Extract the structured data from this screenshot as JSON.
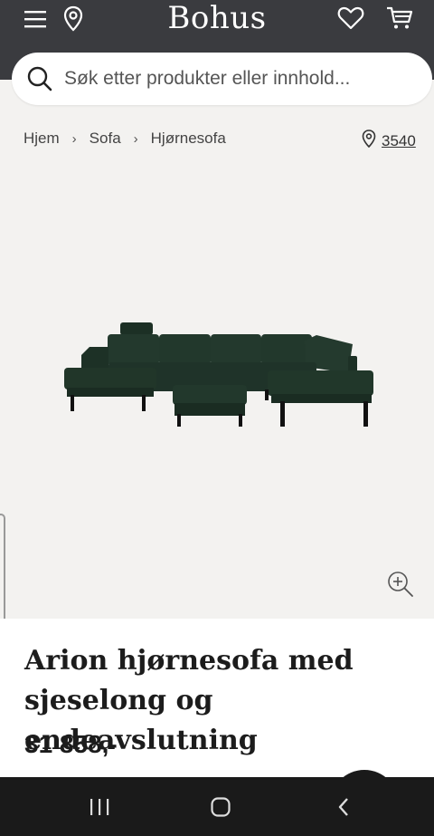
{
  "header": {
    "logo": "Bohus",
    "menu_icon": "hamburger-menu-icon",
    "location_icon": "map-pin-icon",
    "wishlist_icon": "heart-icon",
    "cart_icon": "shopping-cart-icon"
  },
  "search": {
    "placeholder": "Søk etter produkter eller innhold..."
  },
  "breadcrumb": {
    "items": [
      "Hjem",
      "Sofa",
      "Hjørnesofa"
    ],
    "separator": "›"
  },
  "store": {
    "code": "3540"
  },
  "product": {
    "title": "Arion hjørnesofa med sjeselong og endeavslutning",
    "price": "31 858,-",
    "image_description_color": "#1f3328"
  },
  "colors": {
    "header_bg": "#3a3b3f",
    "page_bg": "#f3f2f0",
    "sofa": "#20352a"
  }
}
